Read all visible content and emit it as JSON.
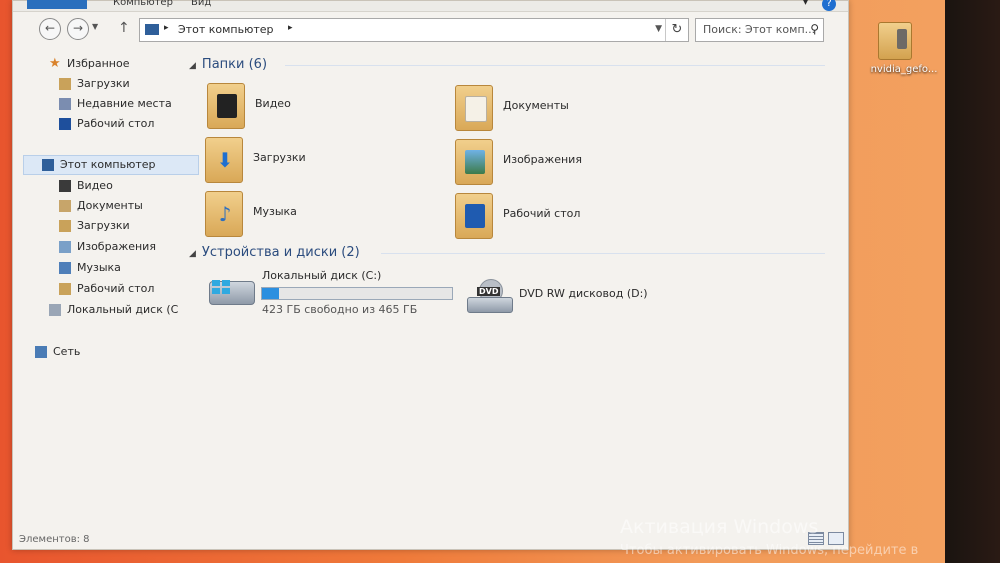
{
  "ribbon": {
    "tab_file": "",
    "tab_computer": "Компьютер",
    "tab_view": "Вид",
    "help": "?"
  },
  "nav": {
    "back_icon": "arrow-left-icon",
    "forward_icon": "arrow-right-icon",
    "up_icon": "arrow-up-icon",
    "address_path": "Этот компьютер",
    "search_placeholder": "Поиск: Этот комп..."
  },
  "sidebar": {
    "favorites": "Избранное",
    "fav_items": [
      "Загрузки",
      "Недавние места",
      "Рабочий стол"
    ],
    "this_pc": "Этот компьютер",
    "pc_items": [
      "Видео",
      "Документы",
      "Загрузки",
      "Изображения",
      "Музыка",
      "Рабочий стол",
      "Локальный диск (C"
    ],
    "network": "Сеть"
  },
  "content": {
    "folders_header": "Папки (6)",
    "folders": [
      "Видео",
      "Документы",
      "Загрузки",
      "Изображения",
      "Музыка",
      "Рабочий стол"
    ],
    "devices_header": "Устройства и диски (2)",
    "drive_c": {
      "name": "Локальный диск (C:)",
      "free": "423 ГБ свободно из 465 ГБ",
      "used_fraction": 0.09
    },
    "drive_d": {
      "name": "DVD RW дисковод (D:)",
      "badge": "DVD"
    }
  },
  "status": {
    "items": "Элементов: 8"
  },
  "watermark": {
    "line1": "Активация Windows",
    "line2": "Чтобы активировать Windows, перейдите в"
  },
  "desktop": {
    "icon_label": "nvidia_gefo..."
  },
  "colors": {
    "accent": "#2a6fbd",
    "progress": "#2b8fe0",
    "folder": "#e3b86a"
  }
}
